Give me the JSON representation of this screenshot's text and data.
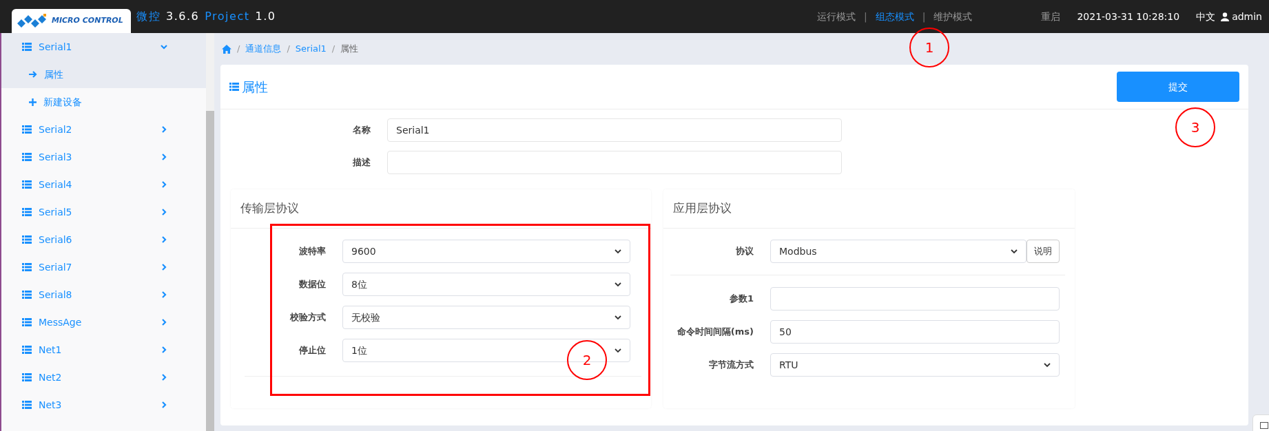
{
  "topbar": {
    "logo_text": "MICRO CONTROL",
    "title": [
      {
        "text": "微控",
        "kind": "name"
      },
      {
        "text": "3.6.6",
        "kind": "version"
      },
      {
        "text": "Project",
        "kind": "name"
      },
      {
        "text": "1.0",
        "kind": "version"
      }
    ],
    "modes": [
      {
        "label": "运行模式",
        "selected": false
      },
      {
        "label": "组态模式",
        "selected": true
      },
      {
        "label": "维护模式",
        "selected": false
      }
    ],
    "separators": [
      "|",
      "|"
    ],
    "restart": "重启",
    "datetime": "2021-03-31 10:28:10",
    "language": "中文",
    "user": "admin"
  },
  "sidebar": {
    "items": [
      {
        "label": "Serial1",
        "expanded": true,
        "children": [
          {
            "label": "属性",
            "kind": "page",
            "selected": true
          },
          {
            "label": "新建设备",
            "kind": "add",
            "selected": false
          }
        ]
      },
      {
        "label": "Serial2",
        "expanded": false
      },
      {
        "label": "Serial3",
        "expanded": false
      },
      {
        "label": "Serial4",
        "expanded": false
      },
      {
        "label": "Serial5",
        "expanded": false
      },
      {
        "label": "Serial6",
        "expanded": false
      },
      {
        "label": "Serial7",
        "expanded": false
      },
      {
        "label": "Serial8",
        "expanded": false
      },
      {
        "label": "MessAge",
        "expanded": false
      },
      {
        "label": "Net1",
        "expanded": false
      },
      {
        "label": "Net2",
        "expanded": false
      },
      {
        "label": "Net3",
        "expanded": false
      }
    ]
  },
  "breadcrumb": [
    {
      "separator": "/",
      "label": "通道信息",
      "kind": "link"
    },
    {
      "separator": "/",
      "label": "Serial1",
      "kind": "link"
    },
    {
      "separator": "/",
      "label": "属性",
      "kind": "current"
    }
  ],
  "card": {
    "title": "属性",
    "submit": "提交",
    "fields": [
      {
        "label": "名称",
        "value": "Serial1"
      },
      {
        "label": "描述"
      }
    ],
    "sections": [
      {
        "title": "传输层协议",
        "rows": [
          {
            "label": "波特率",
            "kind": "select",
            "value": "9600"
          },
          {
            "label": "数据位",
            "kind": "select",
            "value": "8位"
          },
          {
            "label": "校验方式",
            "kind": "select",
            "value": "无校验"
          },
          {
            "label": "停止位",
            "kind": "select",
            "value": "1位"
          }
        ]
      },
      {
        "title": "应用层协议",
        "rows": [
          {
            "label": "协议",
            "kind": "select",
            "value": "Modbus",
            "button": "说明"
          },
          {
            "kind": "divider"
          },
          {
            "label": "参数1",
            "kind": "input"
          },
          {
            "label": "命令时间间隔(ms)",
            "kind": "input",
            "value": "50"
          },
          {
            "label": "字节流方式",
            "kind": "select",
            "value": "RTU"
          }
        ]
      }
    ]
  },
  "annotations": [
    {
      "kind": "circle",
      "label": "1"
    },
    {
      "kind": "rect"
    },
    {
      "kind": "circle",
      "label": "2"
    },
    {
      "kind": "circle",
      "label": "3"
    }
  ]
}
